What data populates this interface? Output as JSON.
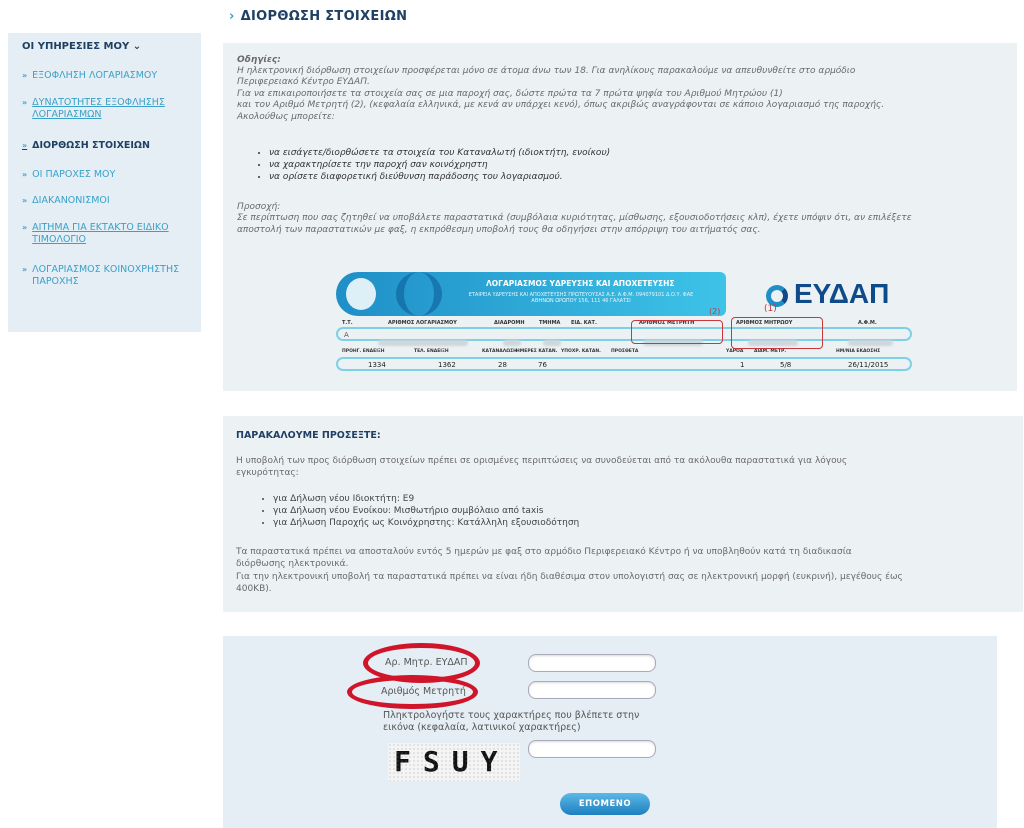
{
  "sidebar": {
    "heading": "ΟΙ ΥΠΗΡΕΣΙΕΣ ΜΟΥ ⌄",
    "items": [
      {
        "label": "ΕΞΟΦΛΗΣΗ ΛΟΓΑΡΙΑΣΜΟΥ"
      },
      {
        "label": "ΔΥΝΑΤΟΤΗΤΕΣ ΕΞΟΦΛΗΣΗΣ ΛΟΓΑΡΙΑΣΜΩΝ"
      },
      {
        "label": "ΔΙΟΡΘΩΣΗ ΣΤΟΙΧΕΙΩΝ"
      },
      {
        "label": "ΟΙ ΠΑΡΟΧΕΣ ΜΟΥ"
      },
      {
        "label": "ΔΙΑΚΑΝΟΝΙΣΜΟΙ"
      },
      {
        "label": "ΑΙΤΗΜΑ ΓΙΑ ΕΚΤΑΚΤΟ ΕΙΔΙΚΟ ΤΙΜΟΛΟΓΙΟ"
      },
      {
        "label": "ΛΟΓΑΡΙΑΣΜΟΣ ΚΟΙΝΟΧΡΗΣΤΗΣ ΠΑΡΟΧΗΣ"
      }
    ],
    "arrow": "»"
  },
  "page": {
    "chevron": "›",
    "title": "ΔΙΟΡΘΩΣΗ ΣΤΟΙΧΕΙΩΝ"
  },
  "instructions": {
    "heading": "Οδηγίες:",
    "line1": "Η ηλεκτρονική διόρθωση στοιχείων προσφέρεται μόνο σε άτομα άνω των 18. Για ανηλίκους παρακαλούμε να απευθυνθείτε στο αρμόδιο",
    "line2": "Περιφερειακό Κέντρο ΕΥΔΑΠ.",
    "line3": "Για να επικαιροποιήσετε τα στοιχεία σας σε μια παροχή σας, δώστε πρώτα τα 7 πρώτα ψηφία του Αριθμού Μητρώου (1)",
    "line4": "και τον Αριθμό Μετρητή (2), (κεφαλαία ελληνικά, με κενά αν υπάρχει κενό), όπως ακριβώς αναγράφονται σε κάποιο λογαριασμό της παροχής.",
    "line5": "Ακολούθως μπορείτε:",
    "bullets": [
      "να εισάγετε/διορθώσετε τα στοιχεία του Καταναλωτή (ιδιοκτήτη, ενοίκου)",
      "να χαρακτηρίσετε την παροχή σαν κοινόχρηστη",
      "να ορίσετε διαφορετική διεύθυνση παράδοσης του λογαριασμού."
    ],
    "note_heading": "Προσοχή:",
    "note1": "Σε περίπτωση που σας ζητηθεί να υποβάλετε παραστατικά (συμβόλαια κυριότητας, μίσθωσης, εξουσιοδοτήσεις κλπ), έχετε υπόψιν ότι, αν επιλέξετε",
    "note2": "αποστολή των παραστατικών με φαξ, η εκπρόθεσμη υποβολή τους θα οδηγήσει στην απόρριψη του αιτήματός σας."
  },
  "bill": {
    "header_title": "ΛΟΓΑΡΙΑΣΜΟΣ ΥΔΡΕΥΣΗΣ ΚΑΙ ΑΠΟΧΕΤΕΥΣΗΣ",
    "header_sub": "ΕΤΑΙΡΕΙΑ ΥΔΡΕΥΣΗΣ ΚΑΙ ΑΠΟΧΕΤΕΥΣΗΣ ΠΡΩΤΕΥΟΥΣΑΣ Α.Ε. Α.Φ.Μ. 094079101 Δ.Ο.Υ. ΦΑΕ ΑΘΗΝΩΝ ΩΡΩΠΟΥ 156, 111 46 ΓΑΛΑΤΣΙ",
    "logo": "ΕΥΔΑΠ",
    "labels": [
      "Τ.Τ.",
      "ΑΡΙΘΜΟΣ ΛΟΓΑΡΙΑΣΜΟΥ",
      "ΔΙΑΔΡΟΜΗ",
      "ΤΜΗΜΑ",
      "ΕΙΔ. ΚΑΤ.",
      "ΑΡΙΘΜΟΣ ΜΕΤΡΗΤΗ",
      "ΑΡΙΘΜΟΣ ΜΗΤΡΩΟΥ",
      "Α.Φ.Μ."
    ],
    "row1_first": "Α",
    "sublabels": [
      "ΠΡΟΗΓ. ΕΝΔΕΙΞΗ",
      "ΤΕΛ. ΕΝΔΕΙΞΗ",
      "ΚΑΤΑΝΑΛΩΣΗ",
      "ΗΜΕΡΕΣ ΚΑΤΑΝ.",
      "ΥΠΟΧΡ. ΚΑΤΑΝ.",
      "ΠΡΟΣΘΕΤΑ",
      "ΥΔΡΟΑ",
      "ΔΙΑΜ. ΜΕΤΡ.",
      "ΗΜ/ΝΙΑ ΕΚΔΟΣΗΣ"
    ],
    "values": [
      "1334",
      "1362",
      "28",
      "76",
      "1",
      "5/8",
      "26/11/2015"
    ],
    "marker1": "(1)",
    "marker2": "(2)"
  },
  "notice": {
    "title": "ΠΑΡΑΚΑΛΟΥΜΕ ΠΡΟΣΕΞΤΕ:",
    "p1a": "Η υποβολή των προς διόρθωση στοιχείων πρέπει σε ορισμένες περιπτώσεις να συνοδεύεται από τα ακόλουθα παραστατικά για λόγους",
    "p1b": "εγκυρότητας:",
    "bullets": [
      "για Δήλωση νέου Ιδιοκτήτη: Ε9",
      "για Δήλωση νέου Ενοίκου: Μισθωτήριο συμβόλαιο από taxis",
      "για Δήλωση Παροχής ως Κοινόχρηστης: Κατάλληλη εξουσιοδότηση"
    ],
    "p2a": "Τα παραστατικά πρέπει να αποσταλούν εντός 5 ημερών με φαξ στο αρμόδιο Περιφερειακό Κέντρο ή να υποβληθούν κατά τη διαδικασία",
    "p2b": "διόρθωσης ηλεκτρονικά.",
    "p3a": "Για την ηλεκτρονική υποβολή τα παραστατικά πρέπει να είναι ήδη διαθέσιμα στον υπολογιστή σας σε ηλεκτρονική μορφή (ευκρινή), μεγέθους έως",
    "p3b": "400KB)."
  },
  "form": {
    "label_registry": "Αρ. Μητρ. ΕΥΔΑΠ",
    "label_meter": "Αριθμός Μετρητή",
    "captcha_instr1": "Πληκτρολογήστε τους χαρακτήρες που βλέπετε στην",
    "captcha_instr2": "εικόνα (κεφαλαία, λατινικοί χαρακτήρες)",
    "captcha_text": "FSUY",
    "registry_value": "",
    "meter_value": "",
    "captcha_value": "",
    "next_label": "ΕΠΟΜΕΝΟ"
  },
  "colors": {
    "navy": "#1f3f63",
    "link": "#3aa0c9",
    "annotation_red": "#d0142a"
  }
}
